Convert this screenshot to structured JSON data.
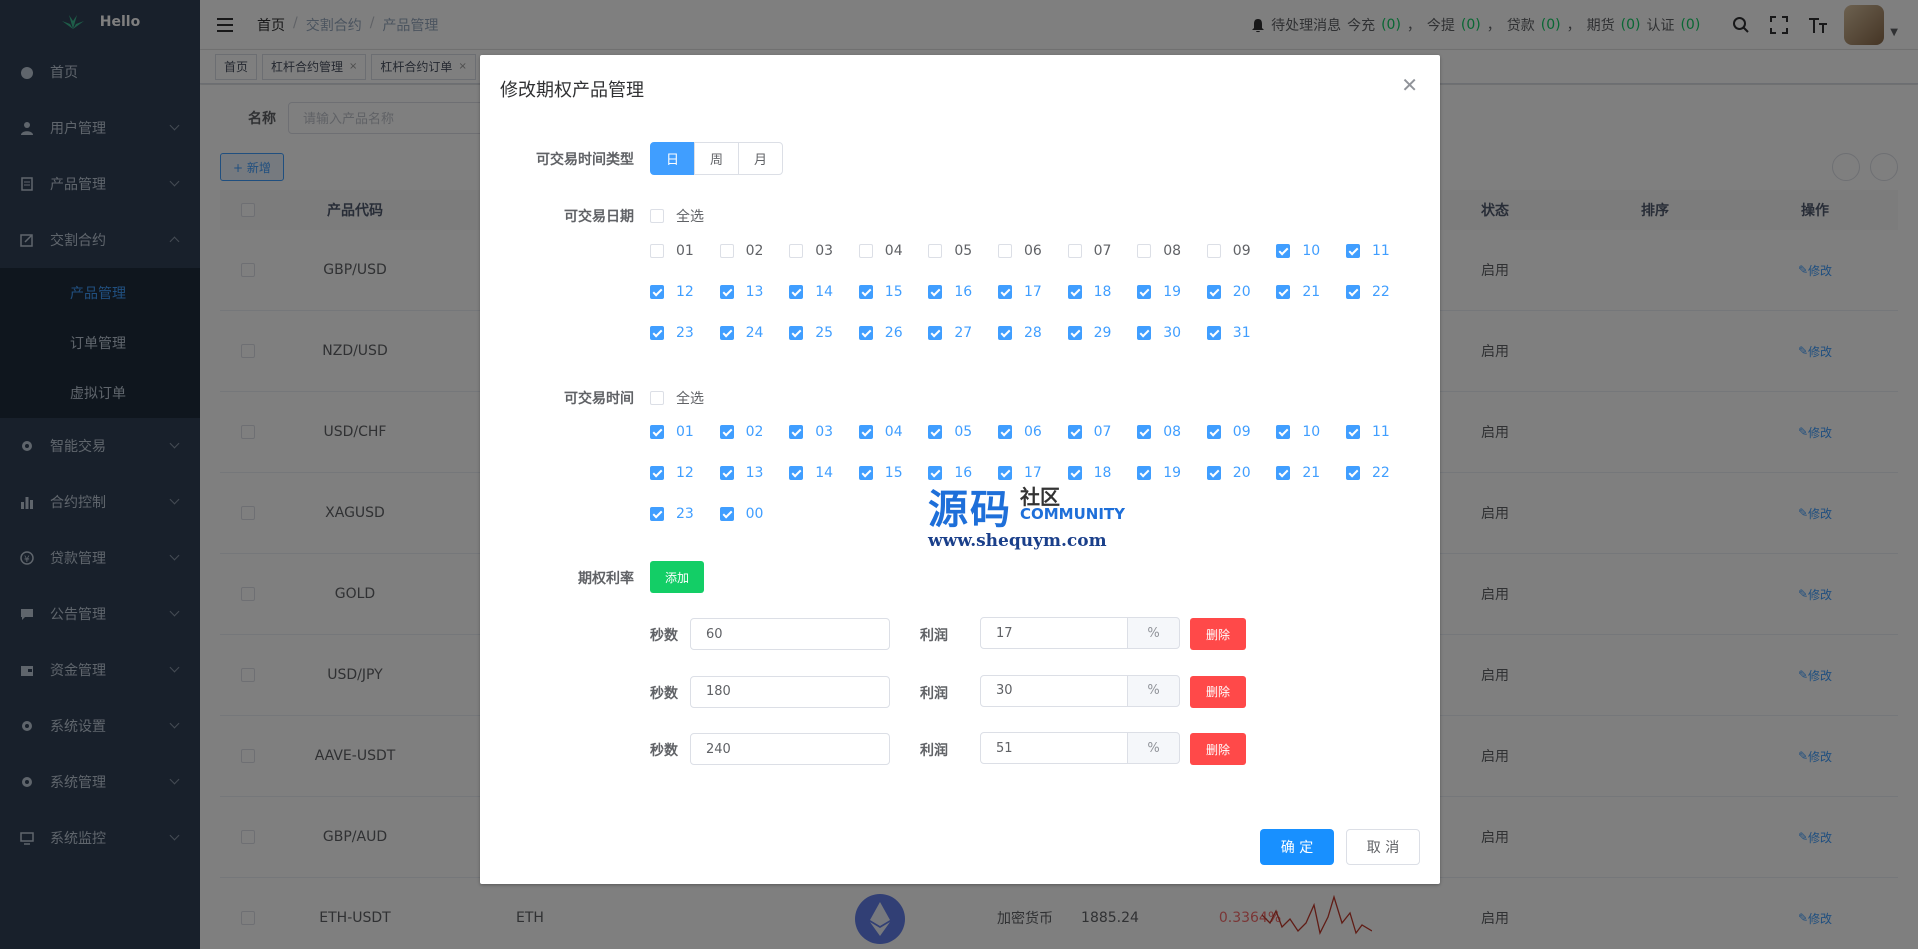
{
  "sidebar": {
    "logo": "Hello",
    "items": [
      {
        "label": "首页",
        "icon": "dashboard-icon"
      },
      {
        "label": "用户管理",
        "icon": "user-icon"
      },
      {
        "label": "产品管理",
        "icon": "document-icon"
      },
      {
        "label": "交割合约",
        "icon": "edit-icon"
      },
      {
        "label": "智能交易",
        "icon": "gear-icon"
      },
      {
        "label": "合约控制",
        "icon": "chart-icon"
      },
      {
        "label": "贷款管理",
        "icon": "money-icon"
      },
      {
        "label": "公告管理",
        "icon": "message-icon"
      },
      {
        "label": "资金管理",
        "icon": "wallet-icon"
      },
      {
        "label": "系统设置",
        "icon": "gear-icon"
      },
      {
        "label": "系统管理",
        "icon": "gear-icon"
      },
      {
        "label": "系统监控",
        "icon": "monitor-icon"
      }
    ],
    "sub_items": [
      "产品管理",
      "订单管理",
      "虚拟订单"
    ]
  },
  "navbar": {
    "breadcrumb": [
      "首页",
      "交割合约",
      "产品管理"
    ],
    "pending_label": "待处理消息",
    "stats": [
      {
        "label": "今充",
        "count": "(0)"
      },
      {
        "label": "今提",
        "count": "(0)"
      },
      {
        "label": "贷款",
        "count": "(0)"
      },
      {
        "label": "期货",
        "count": "(0)"
      },
      {
        "label": "认证",
        "count": "(0)"
      }
    ],
    "sep": "，"
  },
  "tags": [
    {
      "label": "首页",
      "closable": false
    },
    {
      "label": "杠杆合约管理",
      "closable": true
    },
    {
      "label": "杠杆合约订单",
      "closable": true
    }
  ],
  "search": {
    "label": "名称",
    "placeholder": "请输入产品名称"
  },
  "add_button": "+ 新增",
  "table": {
    "headers": {
      "code": "产品代码",
      "status": "状态",
      "sort": "排序",
      "action": "操作"
    },
    "rows": [
      {
        "code": "GBP/USD",
        "status": "启用",
        "action": "修改"
      },
      {
        "code": "NZD/USD",
        "status": "启用",
        "action": "修改"
      },
      {
        "code": "USD/CHF",
        "status": "启用",
        "action": "修改"
      },
      {
        "code": "XAGUSD",
        "status": "启用",
        "action": "修改"
      },
      {
        "code": "GOLD",
        "status": "启用",
        "action": "修改"
      },
      {
        "code": "USD/JPY",
        "status": "启用",
        "action": "修改"
      },
      {
        "code": "AAVE-USDT",
        "status": "启用",
        "action": "修改"
      },
      {
        "code": "GBP/AUD",
        "status": "启用",
        "action": "修改"
      },
      {
        "code": "ETH-USDT",
        "coin": "ETH",
        "type": "加密货币",
        "price": "1885.24",
        "change": "0.3364%",
        "status": "启用",
        "action": "修改"
      }
    ]
  },
  "dialog": {
    "title": "修改期权产品管理",
    "time_type_label": "可交易时间类型",
    "time_types": [
      "日",
      "周",
      "月"
    ],
    "time_type_selected": 0,
    "date_label": "可交易日期",
    "date_select_all": "全选",
    "dates": [
      "01",
      "02",
      "03",
      "04",
      "05",
      "06",
      "07",
      "08",
      "09",
      "10",
      "11",
      "12",
      "13",
      "14",
      "15",
      "16",
      "17",
      "18",
      "19",
      "20",
      "21",
      "22",
      "23",
      "24",
      "25",
      "26",
      "27",
      "28",
      "29",
      "30",
      "31"
    ],
    "dates_checked": [
      false,
      false,
      false,
      false,
      false,
      false,
      false,
      false,
      false,
      true,
      true,
      true,
      true,
      true,
      true,
      true,
      true,
      true,
      true,
      true,
      true,
      true,
      true,
      true,
      true,
      true,
      true,
      true,
      true,
      true,
      true
    ],
    "time_label": "可交易时间",
    "time_select_all": "全选",
    "hours": [
      "01",
      "02",
      "03",
      "04",
      "05",
      "06",
      "07",
      "08",
      "09",
      "10",
      "11",
      "12",
      "13",
      "14",
      "15",
      "16",
      "17",
      "18",
      "19",
      "20",
      "21",
      "22",
      "23",
      "00"
    ],
    "rate_label": "期权利率",
    "add_button": "添加",
    "rates": [
      {
        "sec_label": "秒数",
        "seconds": "60",
        "profit_label": "利润",
        "profit": "17",
        "unit": "%",
        "delete": "删除"
      },
      {
        "sec_label": "秒数",
        "seconds": "180",
        "profit_label": "利润",
        "profit": "30",
        "unit": "%",
        "delete": "删除"
      },
      {
        "sec_label": "秒数",
        "seconds": "240",
        "profit_label": "利润",
        "profit": "51",
        "unit": "%",
        "delete": "删除"
      }
    ],
    "confirm": "确 定",
    "cancel": "取 消"
  },
  "watermark": {
    "main": "源码",
    "cn": "社区",
    "en": "COMMUNITY",
    "url": "www.shequym.com"
  },
  "colors": {
    "primary": "#409eff",
    "sidebar": "#304156",
    "success": "#13ce66",
    "danger": "#ff4949"
  }
}
